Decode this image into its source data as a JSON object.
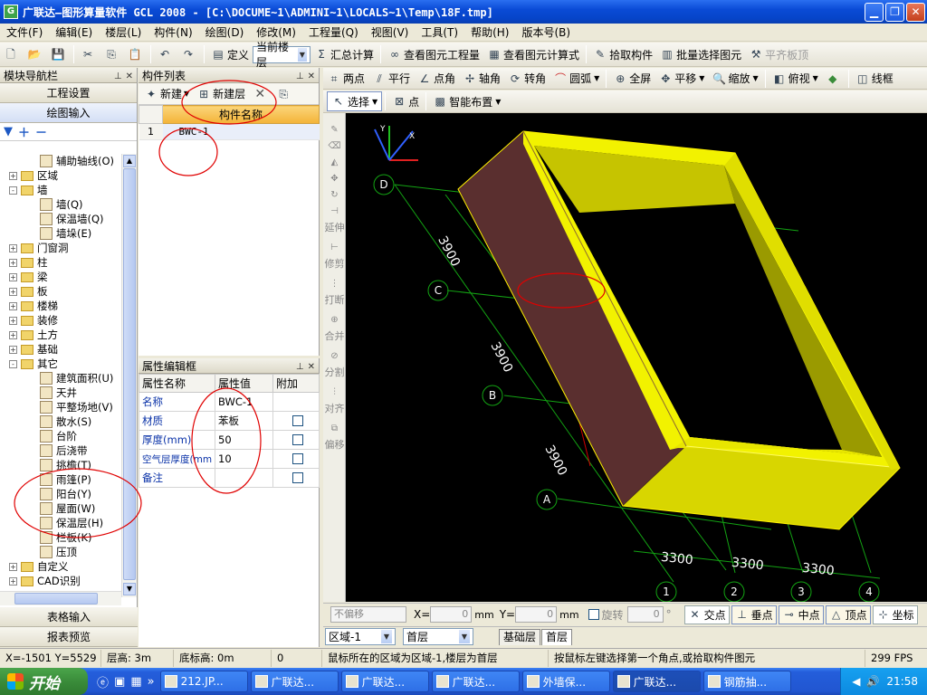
{
  "window": {
    "title": "广联达—图形算量软件 GCL 2008 - [C:\\DOCUME~1\\ADMINI~1\\LOCALS~1\\Temp\\18F.tmp]",
    "app_icon": "G"
  },
  "menu": [
    "文件(F)",
    "编辑(E)",
    "楼层(L)",
    "构件(N)",
    "绘图(D)",
    "修改(M)",
    "工程量(Q)",
    "视图(V)",
    "工具(T)",
    "帮助(H)",
    "版本号(B)"
  ],
  "toolbar": {
    "define_label": "定义",
    "floor_select": "当前楼层",
    "sum_calc_label": "汇总计算",
    "view_quantity_label": "查看图元工程量",
    "view_formula_label": "查看图元计算式",
    "pick_component_label": "拾取构件",
    "batch_select_label": "批量选择图元",
    "flat_slab_label": "平齐板顶"
  },
  "nav": {
    "title": "模块导航栏",
    "project_settings": "工程设置",
    "drawing_input": "绘图输入",
    "table_input": "表格输入",
    "report_preview": "报表预览",
    "tree": [
      {
        "label": "辅助轴线(O)",
        "level": 1,
        "type": "leaf"
      },
      {
        "label": "区域",
        "level": 0,
        "type": "folder",
        "exp": "+"
      },
      {
        "label": "墙",
        "level": 0,
        "type": "folder",
        "exp": "-"
      },
      {
        "label": "墙(Q)",
        "level": 1,
        "type": "leaf"
      },
      {
        "label": "保温墙(Q)",
        "level": 1,
        "type": "leaf"
      },
      {
        "label": "墙垛(E)",
        "level": 1,
        "type": "leaf"
      },
      {
        "label": "门窗洞",
        "level": 0,
        "type": "folder",
        "exp": "+"
      },
      {
        "label": "柱",
        "level": 0,
        "type": "folder",
        "exp": "+"
      },
      {
        "label": "梁",
        "level": 0,
        "type": "folder",
        "exp": "+"
      },
      {
        "label": "板",
        "level": 0,
        "type": "folder",
        "exp": "+"
      },
      {
        "label": "楼梯",
        "level": 0,
        "type": "folder",
        "exp": "+"
      },
      {
        "label": "装修",
        "level": 0,
        "type": "folder",
        "exp": "+"
      },
      {
        "label": "土方",
        "level": 0,
        "type": "folder",
        "exp": "+"
      },
      {
        "label": "基础",
        "level": 0,
        "type": "folder",
        "exp": "+"
      },
      {
        "label": "其它",
        "level": 0,
        "type": "folder",
        "exp": "-"
      },
      {
        "label": "建筑面积(U)",
        "level": 1,
        "type": "leaf"
      },
      {
        "label": "天井",
        "level": 1,
        "type": "leaf"
      },
      {
        "label": "平整场地(V)",
        "level": 1,
        "type": "leaf"
      },
      {
        "label": "散水(S)",
        "level": 1,
        "type": "leaf"
      },
      {
        "label": "台阶",
        "level": 1,
        "type": "leaf"
      },
      {
        "label": "后浇带",
        "level": 1,
        "type": "leaf"
      },
      {
        "label": "挑檐(T)",
        "level": 1,
        "type": "leaf"
      },
      {
        "label": "雨篷(P)",
        "level": 1,
        "type": "leaf"
      },
      {
        "label": "阳台(Y)",
        "level": 1,
        "type": "leaf"
      },
      {
        "label": "屋面(W)",
        "level": 1,
        "type": "leaf"
      },
      {
        "label": "保温层(H)",
        "level": 1,
        "type": "leaf"
      },
      {
        "label": "栏板(K)",
        "level": 1,
        "type": "leaf"
      },
      {
        "label": "压顶",
        "level": 1,
        "type": "leaf"
      },
      {
        "label": "自定义",
        "level": 0,
        "type": "folder",
        "exp": "+"
      },
      {
        "label": "CAD识别",
        "level": 0,
        "type": "folder",
        "exp": "+"
      }
    ]
  },
  "complist": {
    "title": "构件列表",
    "new_label": "新建",
    "new_layer_label": "新建层",
    "column_header": "构件名称",
    "rows": [
      {
        "no": "1",
        "name": "BWC-1"
      }
    ]
  },
  "props": {
    "title": "属性编辑框",
    "headers": [
      "属性名称",
      "属性值",
      "附加"
    ],
    "rows": [
      {
        "name": "名称",
        "value": "BWC-1",
        "has_check": false
      },
      {
        "name": "材质",
        "value": "苯板",
        "has_check": true
      },
      {
        "name": "厚度(mm)",
        "value": "50",
        "has_check": true
      },
      {
        "name": "空气层厚度(mm",
        "value": "10",
        "has_check": true
      },
      {
        "name": "备注",
        "value": "",
        "has_check": true
      }
    ]
  },
  "drawtb1": [
    "两点",
    "平行",
    "点角",
    "轴角",
    "转角",
    "圆弧",
    "全屏",
    "平移",
    "缩放",
    "俯视",
    "线框"
  ],
  "drawtb2": {
    "select": "选择",
    "point": "点",
    "smart_layout": "智能布置"
  },
  "lefttools": [
    "延伸",
    "修剪",
    "打断",
    "合并",
    "分割",
    "对齐",
    "偏移"
  ],
  "canvas": {
    "axis_labels_rows": [
      "D",
      "C",
      "B",
      "A"
    ],
    "axis_labels_cols": [
      "1",
      "2",
      "3",
      "4"
    ],
    "dim_vertical": [
      "3900",
      "3900",
      "3900"
    ],
    "dim_horizontal": [
      "3300",
      "3300",
      "3300"
    ],
    "colors": {
      "wall_top": "#f2f200",
      "wall_side": "#c6c400",
      "wall_inner": "#9a9a00",
      "wall_front": "#5a2f2f",
      "grid": "#13a313",
      "axisline": "#d00000"
    }
  },
  "snapbar": {
    "no_offset": "不偏移",
    "x_label": "X=",
    "x_value": "0",
    "y_label": "Y=",
    "y_value": "0",
    "unit": "mm",
    "rotate": "旋转",
    "rotate_value": "0",
    "degree": "°",
    "intersect": "交点",
    "perpendicular": "垂点",
    "midpoint": "中点",
    "vertex": "顶点",
    "coord": "坐标"
  },
  "areabar": {
    "region": "区域-1",
    "floor": "首层",
    "tabs": [
      "基础层",
      "首层"
    ]
  },
  "status": {
    "coords": "X=-1501 Y=5529",
    "floor_height": "层高: 3m",
    "base_height": "底标高: 0m",
    "zero": "0",
    "area_info": "鼠标所在的区域为区域-1,楼层为首层",
    "hint": "按鼠标左键选择第一个角点,或拾取构件图元",
    "fps": "299 FPS"
  },
  "taskbar": {
    "start": "开始",
    "tasks": [
      "212.JP...",
      "广联达...",
      "广联达...",
      "广联达...",
      "外墙保...",
      "广联达...",
      "钢筋抽..."
    ],
    "active_index": 5,
    "clock": "21:58"
  }
}
